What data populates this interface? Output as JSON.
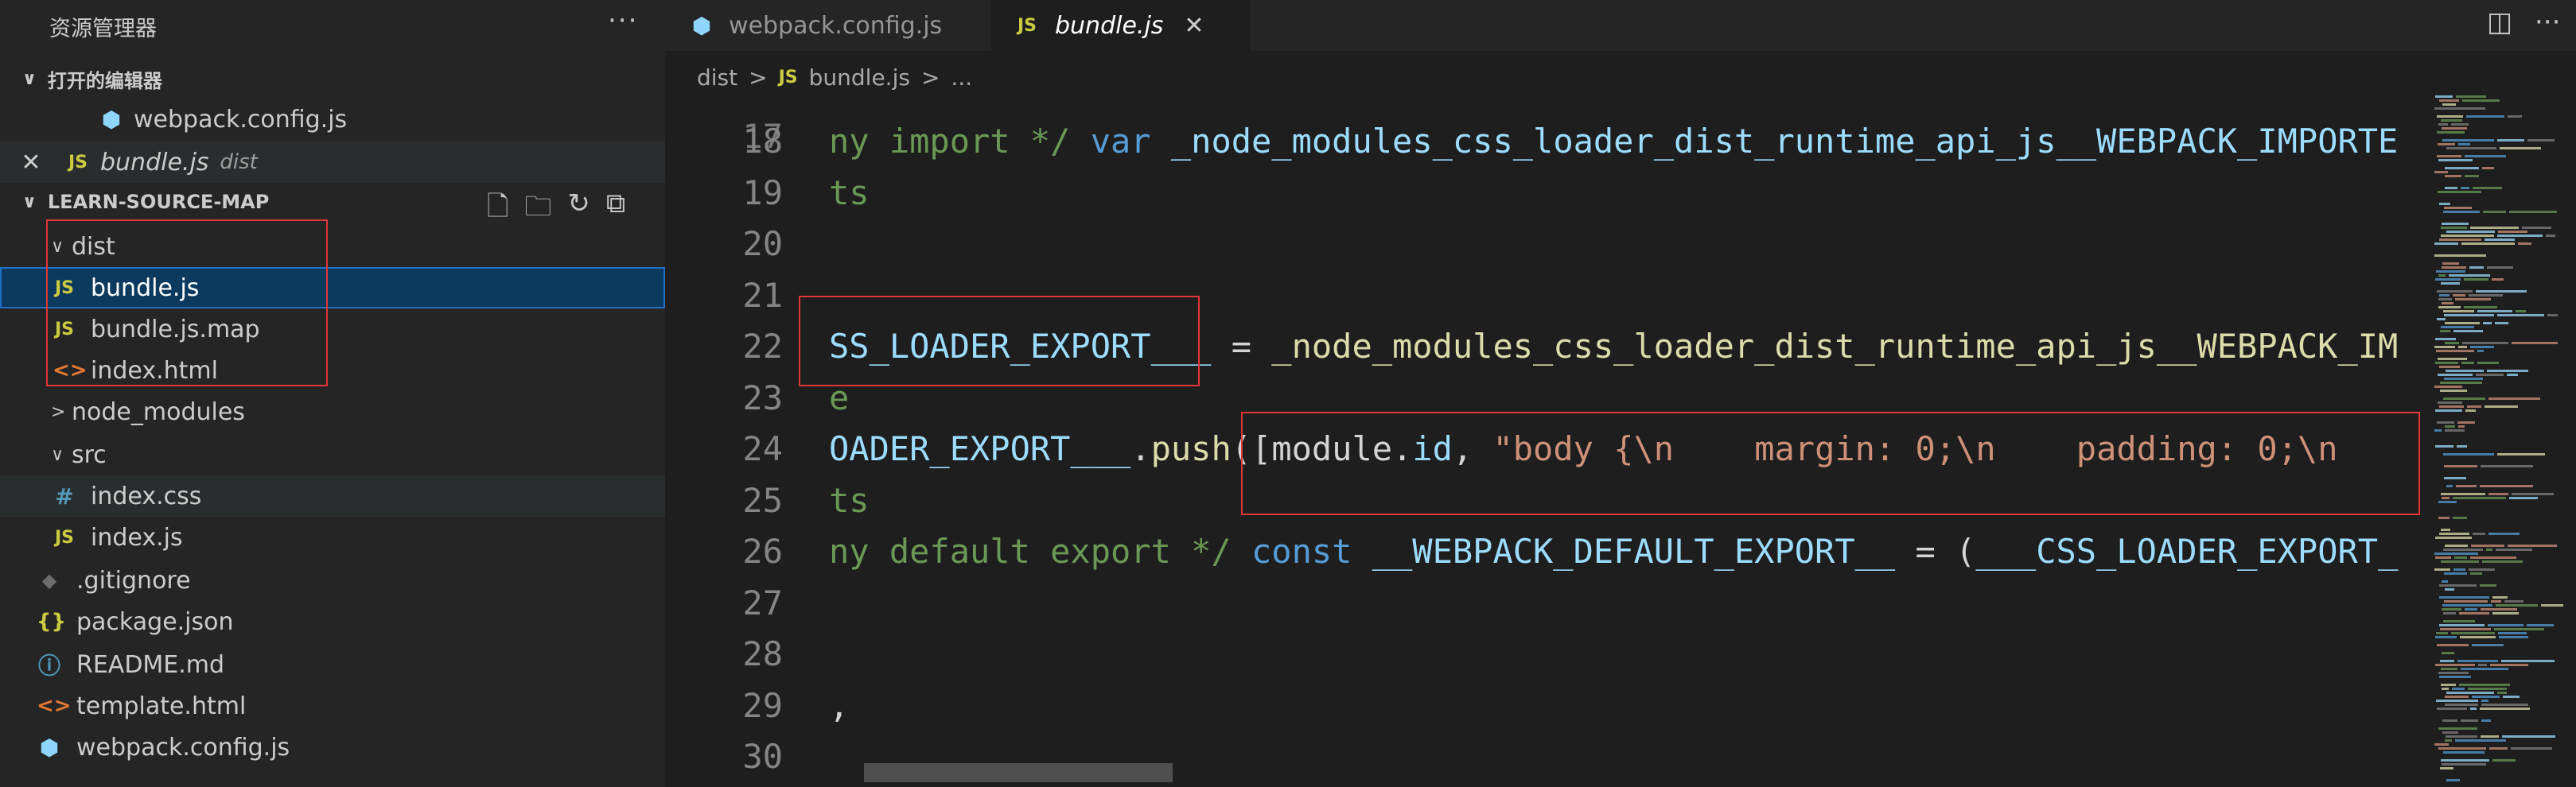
{
  "sidebar": {
    "title": "资源管理器",
    "more": "···",
    "open_editors": {
      "header": "打开的编辑器",
      "items": [
        {
          "name": "webpack.config.js",
          "path": ""
        },
        {
          "name": "bundle.js",
          "path": "dist"
        }
      ]
    },
    "project": {
      "header": "LEARN-SOURCE-MAP",
      "tree": [
        {
          "label": "dist",
          "chev": "∨",
          "icon": ""
        },
        {
          "label": "bundle.js",
          "icon": "JS"
        },
        {
          "label": "bundle.js.map",
          "icon": "JS"
        },
        {
          "label": "index.html",
          "icon": "<>"
        },
        {
          "label": "node_modules",
          "chev": ">",
          "icon": ""
        },
        {
          "label": "src",
          "chev": "∨",
          "icon": ""
        },
        {
          "label": "index.css",
          "icon": "#"
        },
        {
          "label": "index.js",
          "icon": "JS"
        },
        {
          "label": ".gitignore",
          "icon": "◆"
        },
        {
          "label": "package.json",
          "icon": "{}"
        },
        {
          "label": "README.md",
          "icon": "ⓘ"
        },
        {
          "label": "template.html",
          "icon": "<>"
        },
        {
          "label": "webpack.config.js",
          "icon": "⬢"
        }
      ]
    }
  },
  "tabs": [
    {
      "label": "webpack.config.js",
      "active": false
    },
    {
      "label": "bundle.js",
      "active": true
    }
  ],
  "breadcrumb": {
    "parts": [
      "dist",
      ">",
      "JS",
      "bundle.js",
      ">",
      "..."
    ]
  },
  "editor": {
    "lines": [
      {
        "num": "18",
        "tokens": [
          [
            "cm",
            "ny import */ "
          ],
          [
            "kw",
            "var "
          ],
          [
            "id",
            "_node_modules_css_loader_dist_runtime_api_js__WEBPACK_IMPORTE"
          ]
        ]
      },
      {
        "num": "19",
        "tokens": [
          [
            "cm",
            "ts"
          ]
        ]
      },
      {
        "num": "20",
        "tokens": []
      },
      {
        "num": "21",
        "tokens": []
      },
      {
        "num": "22",
        "tokens": [
          [
            "id",
            "SS_LOADER_EXPORT___"
          ],
          [
            "pl",
            " = "
          ],
          [
            "fn",
            "_node_modules_css_loader_dist_runtime_api_js__WEBPACK_IM"
          ]
        ]
      },
      {
        "num": "23",
        "tokens": [
          [
            "cm",
            "e"
          ]
        ]
      },
      {
        "num": "24",
        "tokens": [
          [
            "id",
            "OADER_EXPORT___"
          ],
          [
            "pl",
            "."
          ],
          [
            "fn",
            "push"
          ],
          [
            "pl",
            "([module."
          ],
          [
            "id",
            "id"
          ],
          [
            "pl",
            ", "
          ],
          [
            "str",
            "\"body {\\n    margin: 0;\\n    padding: 0;\\n"
          ]
        ]
      },
      {
        "num": "25",
        "tokens": [
          [
            "cm",
            "ts"
          ]
        ]
      },
      {
        "num": "26",
        "tokens": [
          [
            "cm",
            "ny default export */ "
          ],
          [
            "kw",
            "const "
          ],
          [
            "id",
            "__WEBPACK_DEFAULT_EXPORT__"
          ],
          [
            "pl",
            " = ("
          ],
          [
            "id",
            "___CSS_LOADER_EXPORT_"
          ]
        ]
      },
      {
        "num": "27",
        "tokens": []
      },
      {
        "num": "28",
        "tokens": []
      },
      {
        "num": "29",
        "tokens": [
          [
            "pl",
            ","
          ]
        ]
      },
      {
        "num": "30",
        "tokens": []
      }
    ]
  },
  "colors": {
    "highlight_box": "#e03636",
    "selection": "#0c3a5e"
  }
}
